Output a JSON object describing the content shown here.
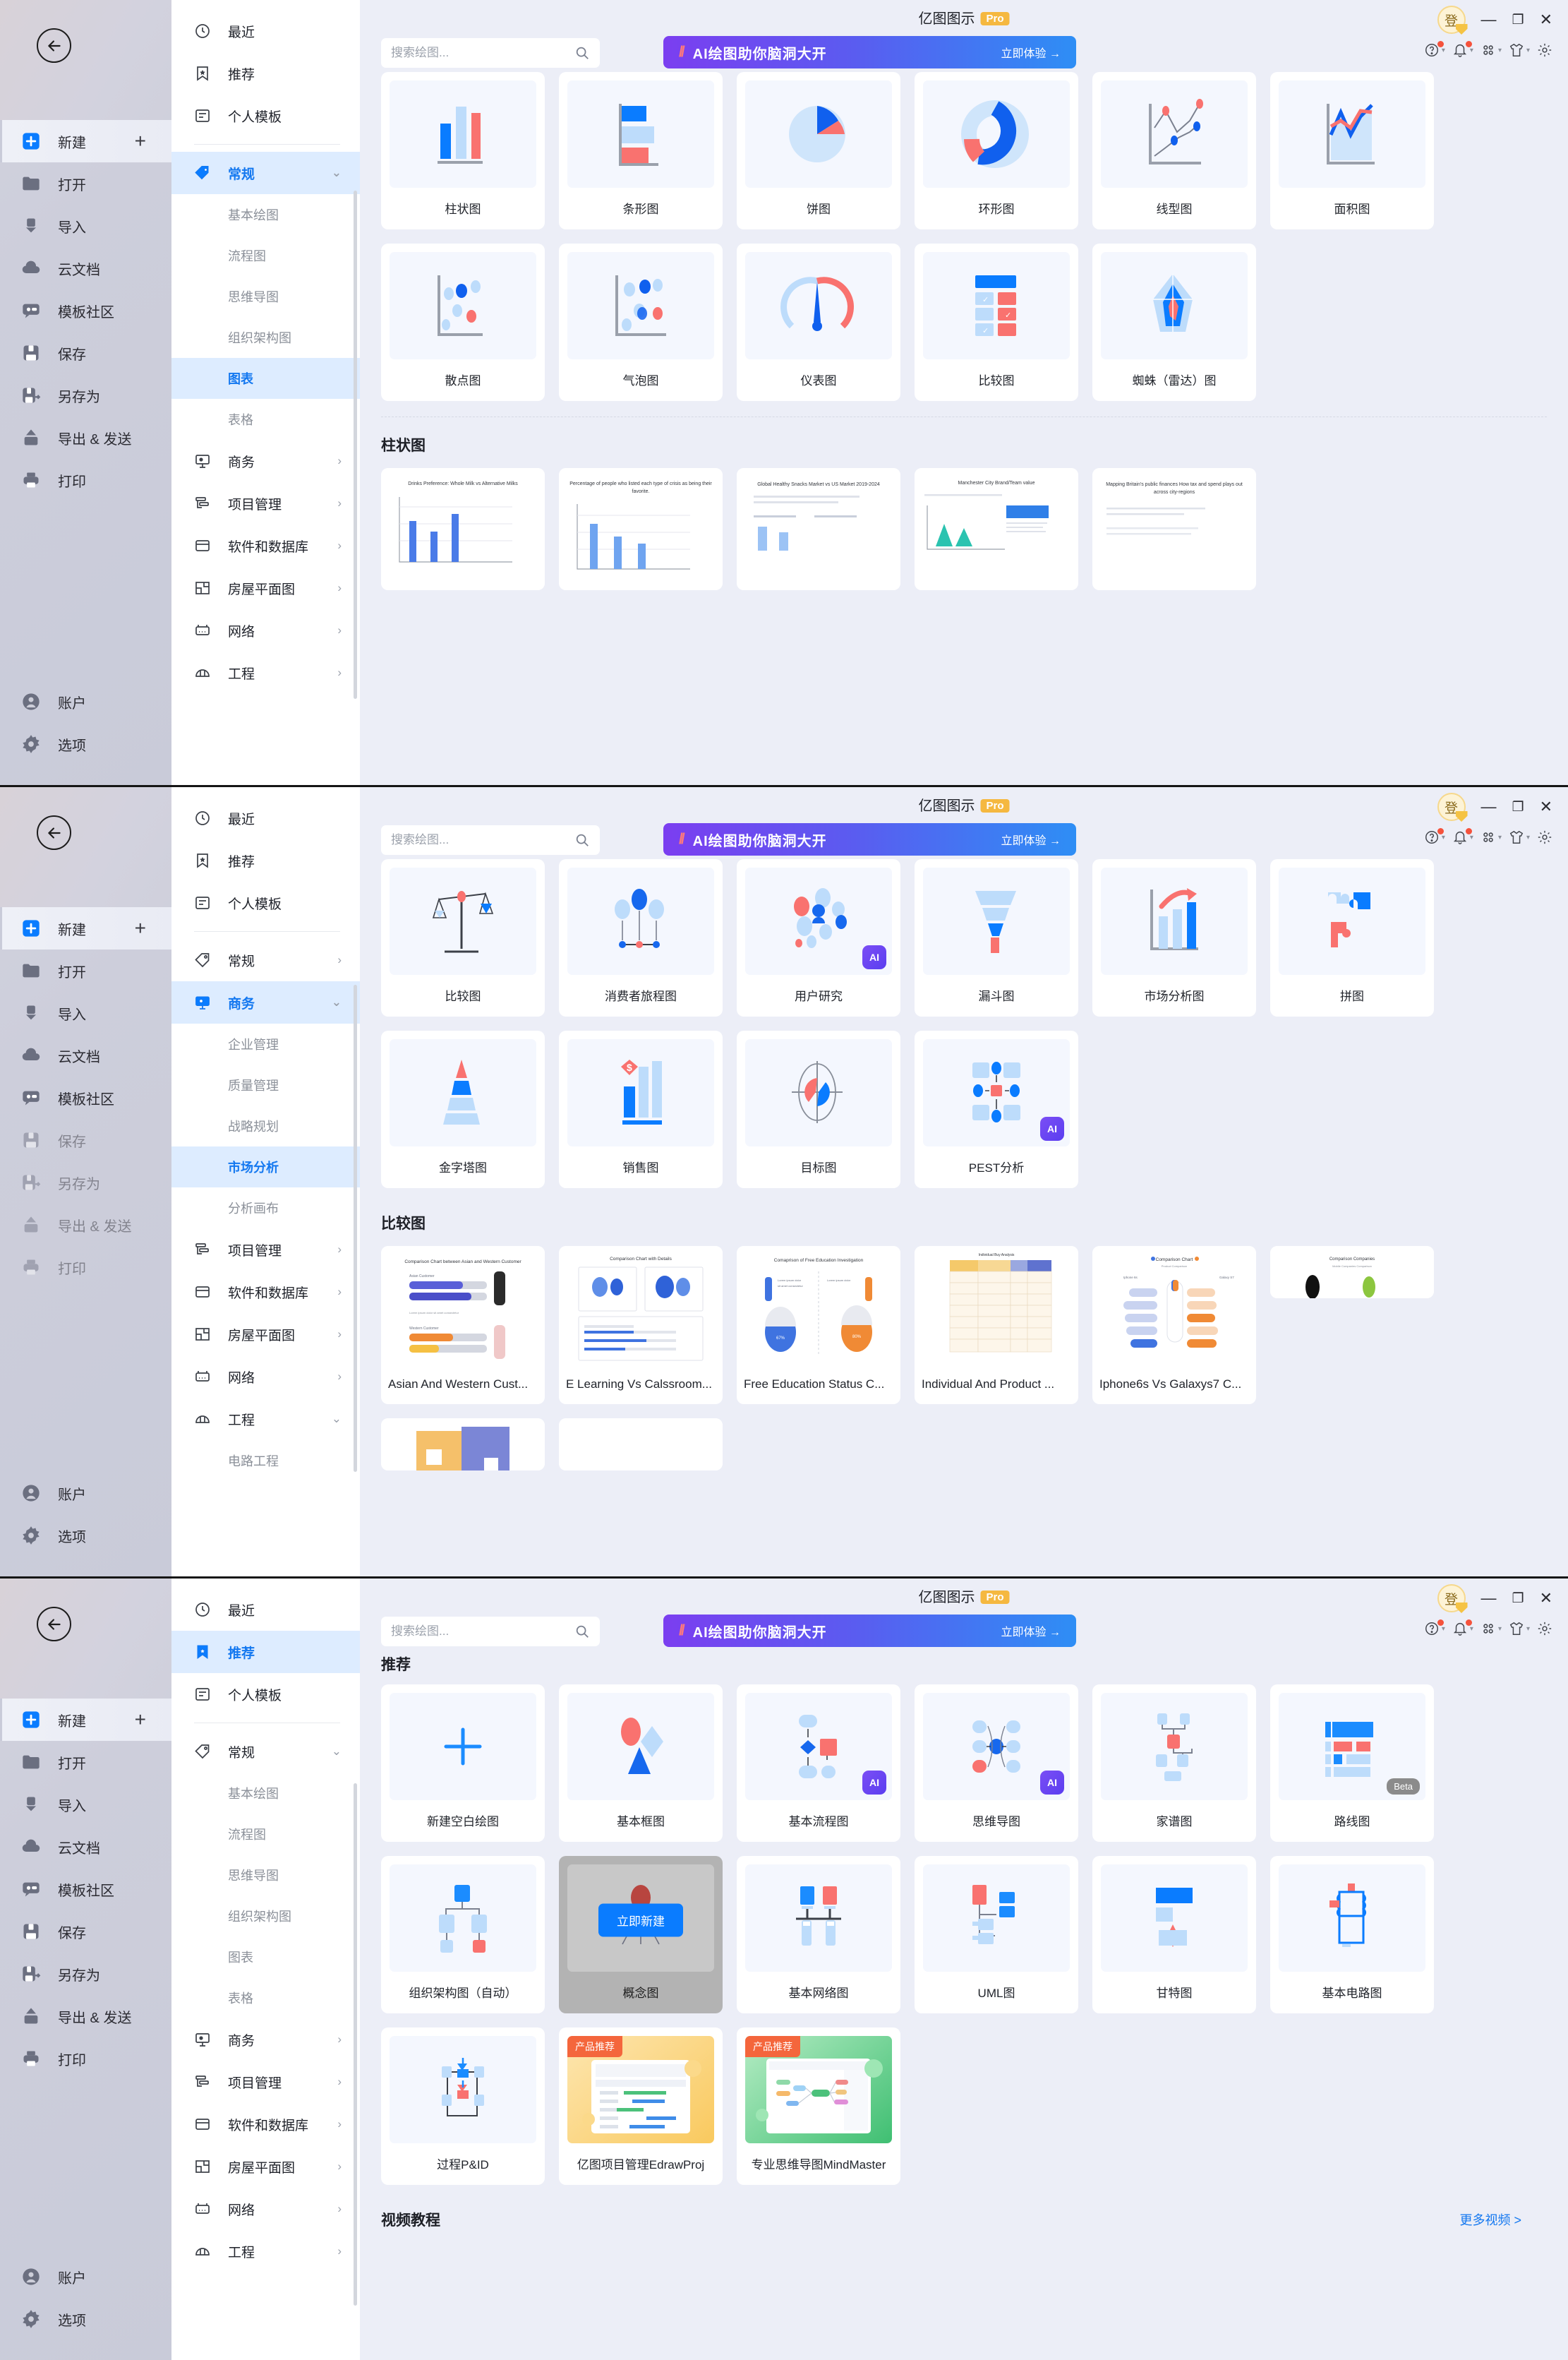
{
  "app": {
    "title": "亿图图示",
    "pro_badge": "Pro",
    "login_label": "登",
    "minimize": "—",
    "maximize": "❐",
    "close": "✕"
  },
  "search": {
    "placeholder": "搜索绘图...",
    "value": "",
    "icon": "search-icon"
  },
  "ai_banner": {
    "text": "AI绘图助你脑洞大开",
    "cta": "立即体验 →"
  },
  "toolbar_icons": [
    "help-icon",
    "bell-icon",
    "apps-icon",
    "shirt-icon",
    "gear-icon"
  ],
  "rail": {
    "items": [
      {
        "label": "新建",
        "icon": "plus-square-icon",
        "active": true,
        "plus": "+"
      },
      {
        "label": "打开",
        "icon": "folder-icon"
      },
      {
        "label": "导入",
        "icon": "import-icon"
      },
      {
        "label": "云文档",
        "icon": "cloud-icon"
      },
      {
        "label": "模板社区",
        "icon": "community-icon"
      },
      {
        "label": "保存",
        "icon": "save-icon"
      },
      {
        "label": "另存为",
        "icon": "save-as-icon"
      },
      {
        "label": "导出 & 发送",
        "icon": "export-icon"
      },
      {
        "label": "打印",
        "icon": "print-icon"
      }
    ],
    "bottom": [
      {
        "label": "账户",
        "icon": "account-icon"
      },
      {
        "label": "选项",
        "icon": "gear-icon"
      }
    ]
  },
  "nav_top": [
    {
      "label": "最近",
      "icon": "clock-icon"
    },
    {
      "label": "推荐",
      "icon": "bookmark-star-icon"
    },
    {
      "label": "个人模板",
      "icon": "personal-template-icon"
    }
  ],
  "nav_groups": [
    {
      "label": "常规",
      "icon": "tag-icon",
      "subs": [
        "基本绘图",
        "流程图",
        "思维导图",
        "组织架构图",
        "图表",
        "表格"
      ]
    },
    {
      "label": "商务",
      "icon": "business-icon",
      "subs": [
        "企业管理",
        "质量管理",
        "战略规划",
        "市场分析",
        "分析画布"
      ]
    },
    {
      "label": "项目管理",
      "icon": "project-icon",
      "subs": []
    },
    {
      "label": "软件和数据库",
      "icon": "database-icon",
      "subs": []
    },
    {
      "label": "房屋平面图",
      "icon": "floorplan-icon",
      "subs": []
    },
    {
      "label": "网络",
      "icon": "network-icon",
      "subs": []
    },
    {
      "label": "工程",
      "icon": "engineering-icon",
      "subs": [
        "电路工程"
      ]
    }
  ],
  "panel1": {
    "nav_selected_group": "常规",
    "nav_selected_sub": "图表",
    "cards": [
      {
        "label": "柱状图",
        "art": "column"
      },
      {
        "label": "条形图",
        "art": "bar"
      },
      {
        "label": "饼图",
        "art": "pie"
      },
      {
        "label": "环形图",
        "art": "donut"
      },
      {
        "label": "线型图",
        "art": "line"
      },
      {
        "label": "面积图",
        "art": "area"
      },
      {
        "label": "散点图",
        "art": "scatter"
      },
      {
        "label": "气泡图",
        "art": "bubble"
      },
      {
        "label": "仪表图",
        "art": "gauge"
      },
      {
        "label": "比较图",
        "art": "compare"
      },
      {
        "label": "蜘蛛（雷达）图",
        "art": "radar"
      }
    ],
    "section_title": "柱状图",
    "templates": [
      "Drinks Preference: Whole Milk vs Alternative Milks",
      "Percentage of people who listed each type of crisis as being their favorite.",
      "Global Healthy Snacks Market vs US Market 2019-2024",
      "Manchester City Brand/Team value",
      "Mapping Britain's public finances How tax and spend plays out across city-regions"
    ]
  },
  "panel2": {
    "nav_selected_group": "商务",
    "nav_selected_sub": "市场分析",
    "cards": [
      {
        "label": "比较图",
        "art": "scale"
      },
      {
        "label": "消费者旅程图",
        "art": "journey"
      },
      {
        "label": "用户研究",
        "art": "research",
        "badge": "AI"
      },
      {
        "label": "漏斗图",
        "art": "funnel"
      },
      {
        "label": "市场分析图",
        "art": "marketanalysis"
      },
      {
        "label": "拼图",
        "art": "puzzle"
      },
      {
        "label": "金字塔图",
        "art": "pyramid"
      },
      {
        "label": "销售图",
        "art": "sales"
      },
      {
        "label": "目标图",
        "art": "target"
      },
      {
        "label": "PEST分析",
        "art": "pest",
        "badge": "AI"
      }
    ],
    "section_title": "比较图",
    "templates": [
      "Asian And Western Cust...",
      "E Learning Vs Calssroom...",
      "Free Education Status C...",
      "Individual And Product ...",
      "Iphone6s Vs Galaxys7 C..."
    ],
    "templates_row2": [
      "Comparison Companies",
      "",
      ""
    ]
  },
  "panel3": {
    "nav_selected_top": "推荐",
    "nav_selected_group": "常规",
    "section_title": "推荐",
    "cards": [
      {
        "label": "新建空白绘图",
        "art": "blank"
      },
      {
        "label": "基本框图",
        "art": "blockdiagram"
      },
      {
        "label": "基本流程图",
        "art": "flowchart",
        "badge": "AI"
      },
      {
        "label": "思维导图",
        "art": "mindmap",
        "badge": "AI"
      },
      {
        "label": "家谱图",
        "art": "genogram"
      },
      {
        "label": "路线图",
        "art": "roadmap",
        "badge": "Beta"
      },
      {
        "label": "组织架构图（自动）",
        "art": "orgauto"
      },
      {
        "label": "概念图",
        "art": "concept",
        "hovered": true,
        "hover_cta": "立即新建"
      },
      {
        "label": "基本网络图",
        "art": "basicnetwork"
      },
      {
        "label": "UML图",
        "art": "uml"
      },
      {
        "label": "甘特图",
        "art": "gantt"
      },
      {
        "label": "基本电路图",
        "art": "circuit"
      },
      {
        "label": "过程P&ID",
        "art": "pid"
      },
      {
        "label": "亿图项目管理EdrawProj",
        "art": "edrawproj",
        "tag": "产品推荐"
      },
      {
        "label": "专业思维导图MindMaster",
        "art": "mindmaster",
        "tag": "产品推荐"
      }
    ],
    "video_section_title": "视频教程",
    "more_videos": "更多视频 >"
  },
  "colors": {
    "accent_blue": "#0a7cff",
    "light_blue": "#bddcfb",
    "coral": "#f9726f",
    "panel_bg": "#eceef7",
    "card_bg": "#ffffff",
    "selected_bg": "#ddecff",
    "badge_yellow": "#f5b840",
    "product_tag": "#f4663c"
  }
}
